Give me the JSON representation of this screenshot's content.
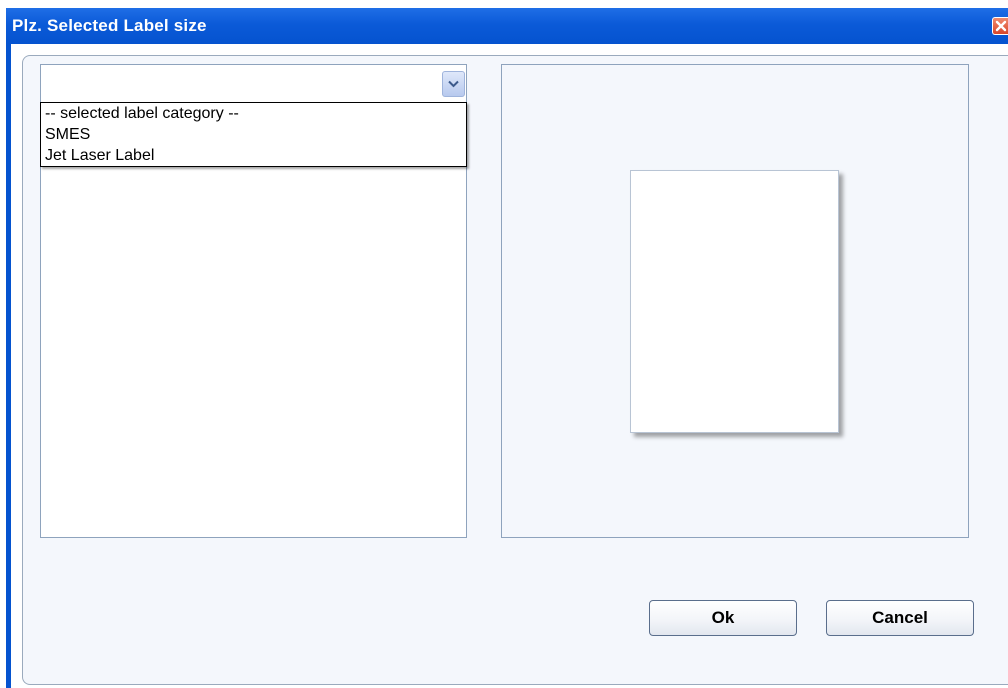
{
  "window": {
    "title": "Plz. Selected Label size"
  },
  "category_combo": {
    "selected_value": "",
    "options": [
      "-- selected label category --",
      "SMES",
      "Jet Laser Label"
    ]
  },
  "buttons": {
    "ok_label": "Ok",
    "cancel_label": "Cancel"
  },
  "icons": {
    "close": "close-icon",
    "dropdown": "chevron-down-icon"
  },
  "colors": {
    "titlebar": "#0553cf",
    "close_button": "#d9462a",
    "panel_border": "#8ea3bd"
  }
}
